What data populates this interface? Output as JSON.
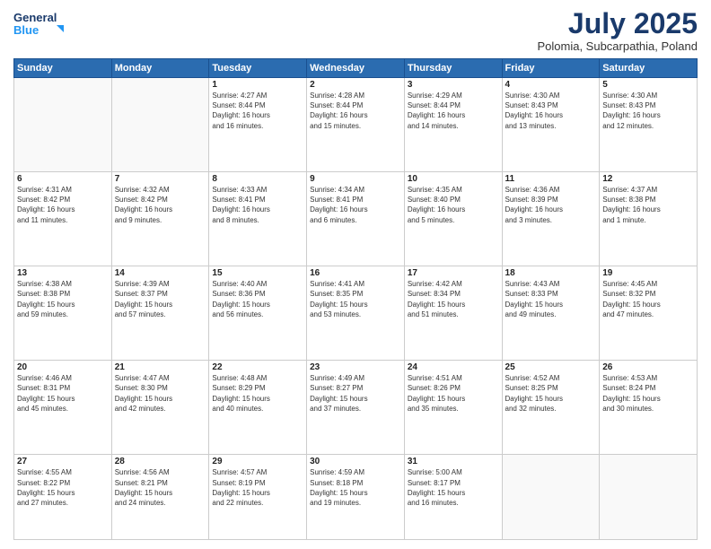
{
  "header": {
    "logo_line1": "General",
    "logo_line2": "Blue",
    "month": "July 2025",
    "location": "Polomia, Subcarpathia, Poland"
  },
  "weekdays": [
    "Sunday",
    "Monday",
    "Tuesday",
    "Wednesday",
    "Thursday",
    "Friday",
    "Saturday"
  ],
  "weeks": [
    [
      {
        "day": "",
        "info": ""
      },
      {
        "day": "",
        "info": ""
      },
      {
        "day": "1",
        "info": "Sunrise: 4:27 AM\nSunset: 8:44 PM\nDaylight: 16 hours\nand 16 minutes."
      },
      {
        "day": "2",
        "info": "Sunrise: 4:28 AM\nSunset: 8:44 PM\nDaylight: 16 hours\nand 15 minutes."
      },
      {
        "day": "3",
        "info": "Sunrise: 4:29 AM\nSunset: 8:44 PM\nDaylight: 16 hours\nand 14 minutes."
      },
      {
        "day": "4",
        "info": "Sunrise: 4:30 AM\nSunset: 8:43 PM\nDaylight: 16 hours\nand 13 minutes."
      },
      {
        "day": "5",
        "info": "Sunrise: 4:30 AM\nSunset: 8:43 PM\nDaylight: 16 hours\nand 12 minutes."
      }
    ],
    [
      {
        "day": "6",
        "info": "Sunrise: 4:31 AM\nSunset: 8:42 PM\nDaylight: 16 hours\nand 11 minutes."
      },
      {
        "day": "7",
        "info": "Sunrise: 4:32 AM\nSunset: 8:42 PM\nDaylight: 16 hours\nand 9 minutes."
      },
      {
        "day": "8",
        "info": "Sunrise: 4:33 AM\nSunset: 8:41 PM\nDaylight: 16 hours\nand 8 minutes."
      },
      {
        "day": "9",
        "info": "Sunrise: 4:34 AM\nSunset: 8:41 PM\nDaylight: 16 hours\nand 6 minutes."
      },
      {
        "day": "10",
        "info": "Sunrise: 4:35 AM\nSunset: 8:40 PM\nDaylight: 16 hours\nand 5 minutes."
      },
      {
        "day": "11",
        "info": "Sunrise: 4:36 AM\nSunset: 8:39 PM\nDaylight: 16 hours\nand 3 minutes."
      },
      {
        "day": "12",
        "info": "Sunrise: 4:37 AM\nSunset: 8:38 PM\nDaylight: 16 hours\nand 1 minute."
      }
    ],
    [
      {
        "day": "13",
        "info": "Sunrise: 4:38 AM\nSunset: 8:38 PM\nDaylight: 15 hours\nand 59 minutes."
      },
      {
        "day": "14",
        "info": "Sunrise: 4:39 AM\nSunset: 8:37 PM\nDaylight: 15 hours\nand 57 minutes."
      },
      {
        "day": "15",
        "info": "Sunrise: 4:40 AM\nSunset: 8:36 PM\nDaylight: 15 hours\nand 56 minutes."
      },
      {
        "day": "16",
        "info": "Sunrise: 4:41 AM\nSunset: 8:35 PM\nDaylight: 15 hours\nand 53 minutes."
      },
      {
        "day": "17",
        "info": "Sunrise: 4:42 AM\nSunset: 8:34 PM\nDaylight: 15 hours\nand 51 minutes."
      },
      {
        "day": "18",
        "info": "Sunrise: 4:43 AM\nSunset: 8:33 PM\nDaylight: 15 hours\nand 49 minutes."
      },
      {
        "day": "19",
        "info": "Sunrise: 4:45 AM\nSunset: 8:32 PM\nDaylight: 15 hours\nand 47 minutes."
      }
    ],
    [
      {
        "day": "20",
        "info": "Sunrise: 4:46 AM\nSunset: 8:31 PM\nDaylight: 15 hours\nand 45 minutes."
      },
      {
        "day": "21",
        "info": "Sunrise: 4:47 AM\nSunset: 8:30 PM\nDaylight: 15 hours\nand 42 minutes."
      },
      {
        "day": "22",
        "info": "Sunrise: 4:48 AM\nSunset: 8:29 PM\nDaylight: 15 hours\nand 40 minutes."
      },
      {
        "day": "23",
        "info": "Sunrise: 4:49 AM\nSunset: 8:27 PM\nDaylight: 15 hours\nand 37 minutes."
      },
      {
        "day": "24",
        "info": "Sunrise: 4:51 AM\nSunset: 8:26 PM\nDaylight: 15 hours\nand 35 minutes."
      },
      {
        "day": "25",
        "info": "Sunrise: 4:52 AM\nSunset: 8:25 PM\nDaylight: 15 hours\nand 32 minutes."
      },
      {
        "day": "26",
        "info": "Sunrise: 4:53 AM\nSunset: 8:24 PM\nDaylight: 15 hours\nand 30 minutes."
      }
    ],
    [
      {
        "day": "27",
        "info": "Sunrise: 4:55 AM\nSunset: 8:22 PM\nDaylight: 15 hours\nand 27 minutes."
      },
      {
        "day": "28",
        "info": "Sunrise: 4:56 AM\nSunset: 8:21 PM\nDaylight: 15 hours\nand 24 minutes."
      },
      {
        "day": "29",
        "info": "Sunrise: 4:57 AM\nSunset: 8:19 PM\nDaylight: 15 hours\nand 22 minutes."
      },
      {
        "day": "30",
        "info": "Sunrise: 4:59 AM\nSunset: 8:18 PM\nDaylight: 15 hours\nand 19 minutes."
      },
      {
        "day": "31",
        "info": "Sunrise: 5:00 AM\nSunset: 8:17 PM\nDaylight: 15 hours\nand 16 minutes."
      },
      {
        "day": "",
        "info": ""
      },
      {
        "day": "",
        "info": ""
      }
    ]
  ]
}
